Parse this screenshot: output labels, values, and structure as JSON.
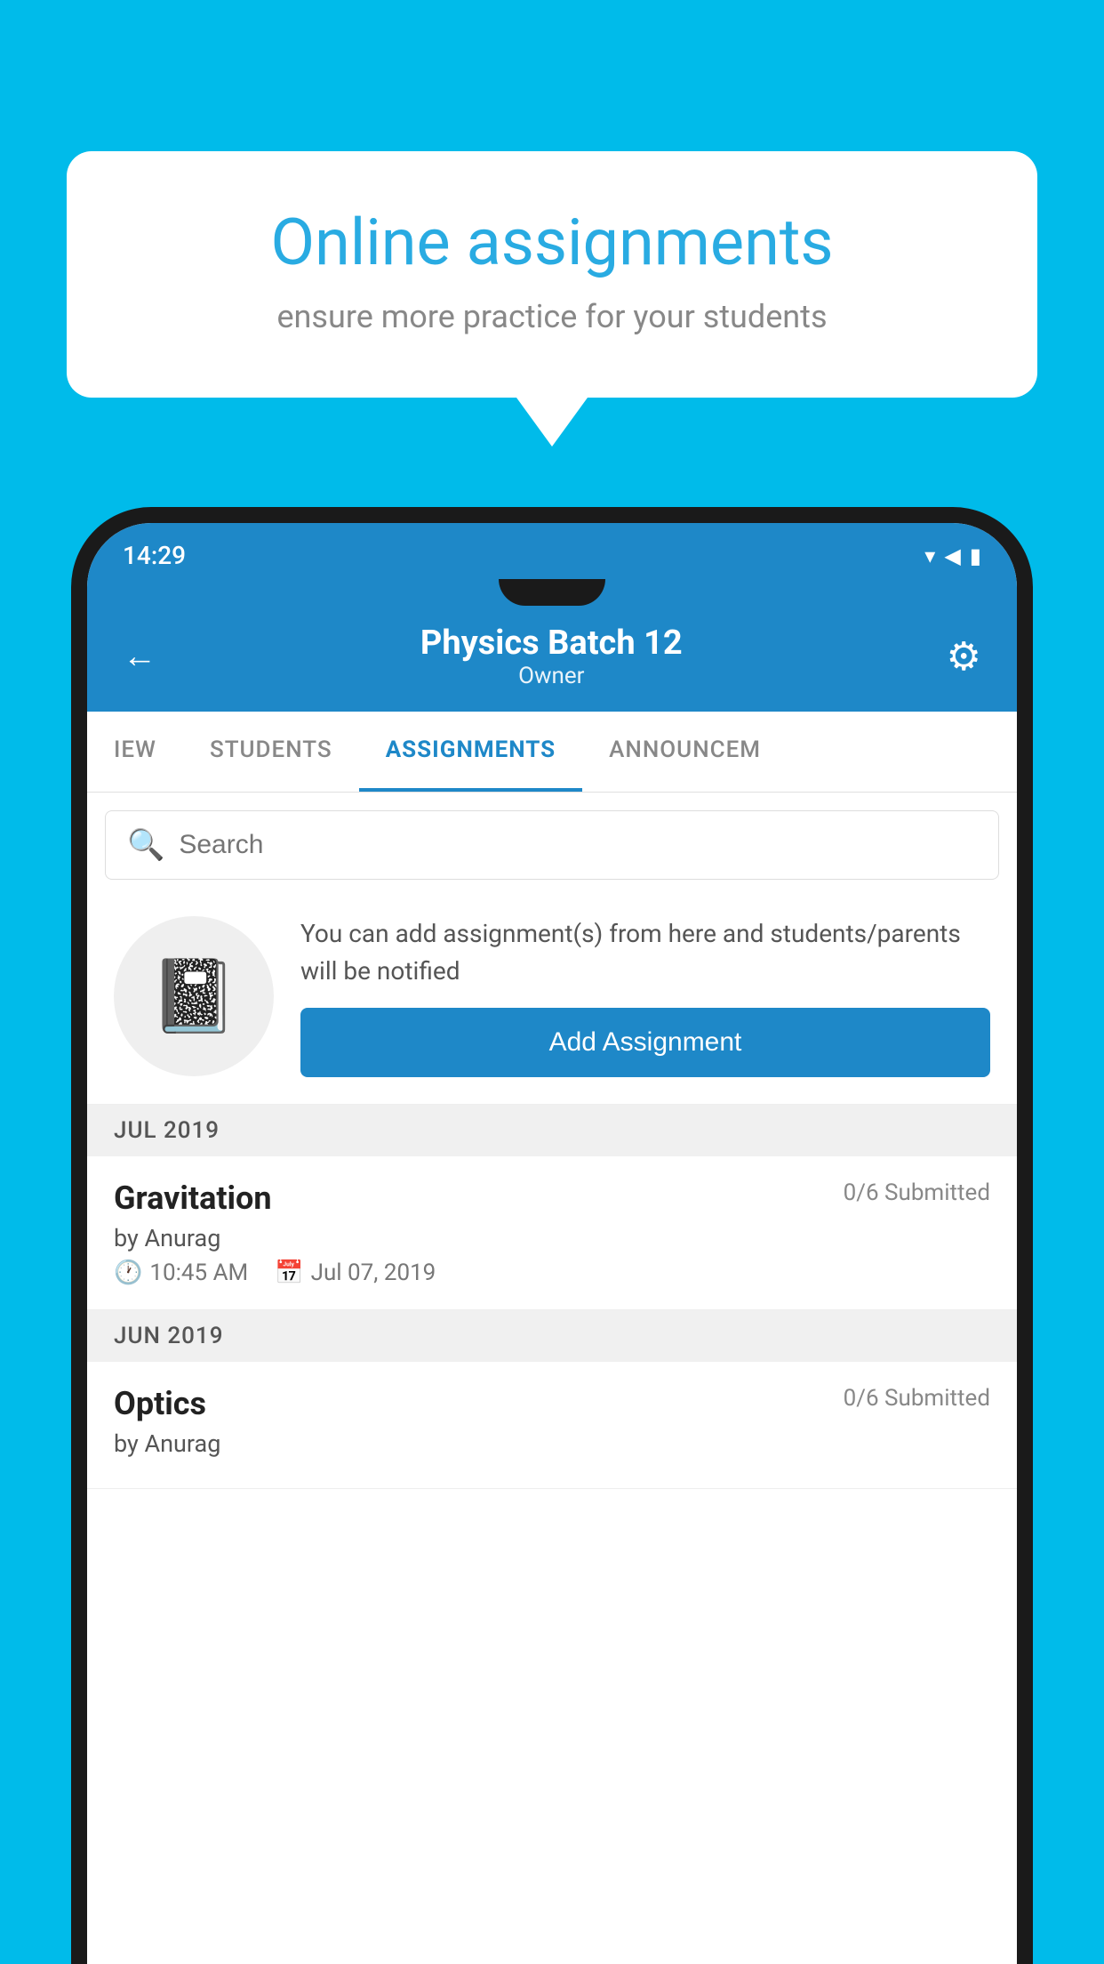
{
  "background_color": "#00BBEA",
  "speech_bubble": {
    "title": "Online assignments",
    "subtitle": "ensure more practice for your students"
  },
  "status_bar": {
    "time": "14:29",
    "icons": "▾◀▮"
  },
  "header": {
    "title": "Physics Batch 12",
    "subtitle": "Owner",
    "back_label": "←",
    "settings_label": "⚙"
  },
  "tabs": [
    {
      "label": "IEW",
      "active": false
    },
    {
      "label": "STUDENTS",
      "active": false
    },
    {
      "label": "ASSIGNMENTS",
      "active": true
    },
    {
      "label": "ANNOUNCEM",
      "active": false
    }
  ],
  "search": {
    "placeholder": "Search"
  },
  "info_card": {
    "description": "You can add assignment(s) from here and students/parents will be notified",
    "button_label": "Add Assignment",
    "icon": "📓"
  },
  "sections": [
    {
      "label": "JUL 2019",
      "assignments": [
        {
          "title": "Gravitation",
          "submitted": "0/6 Submitted",
          "by": "by Anurag",
          "time": "10:45 AM",
          "date": "Jul 07, 2019"
        }
      ]
    },
    {
      "label": "JUN 2019",
      "assignments": [
        {
          "title": "Optics",
          "submitted": "0/6 Submitted",
          "by": "by Anurag",
          "time": "",
          "date": ""
        }
      ]
    }
  ]
}
